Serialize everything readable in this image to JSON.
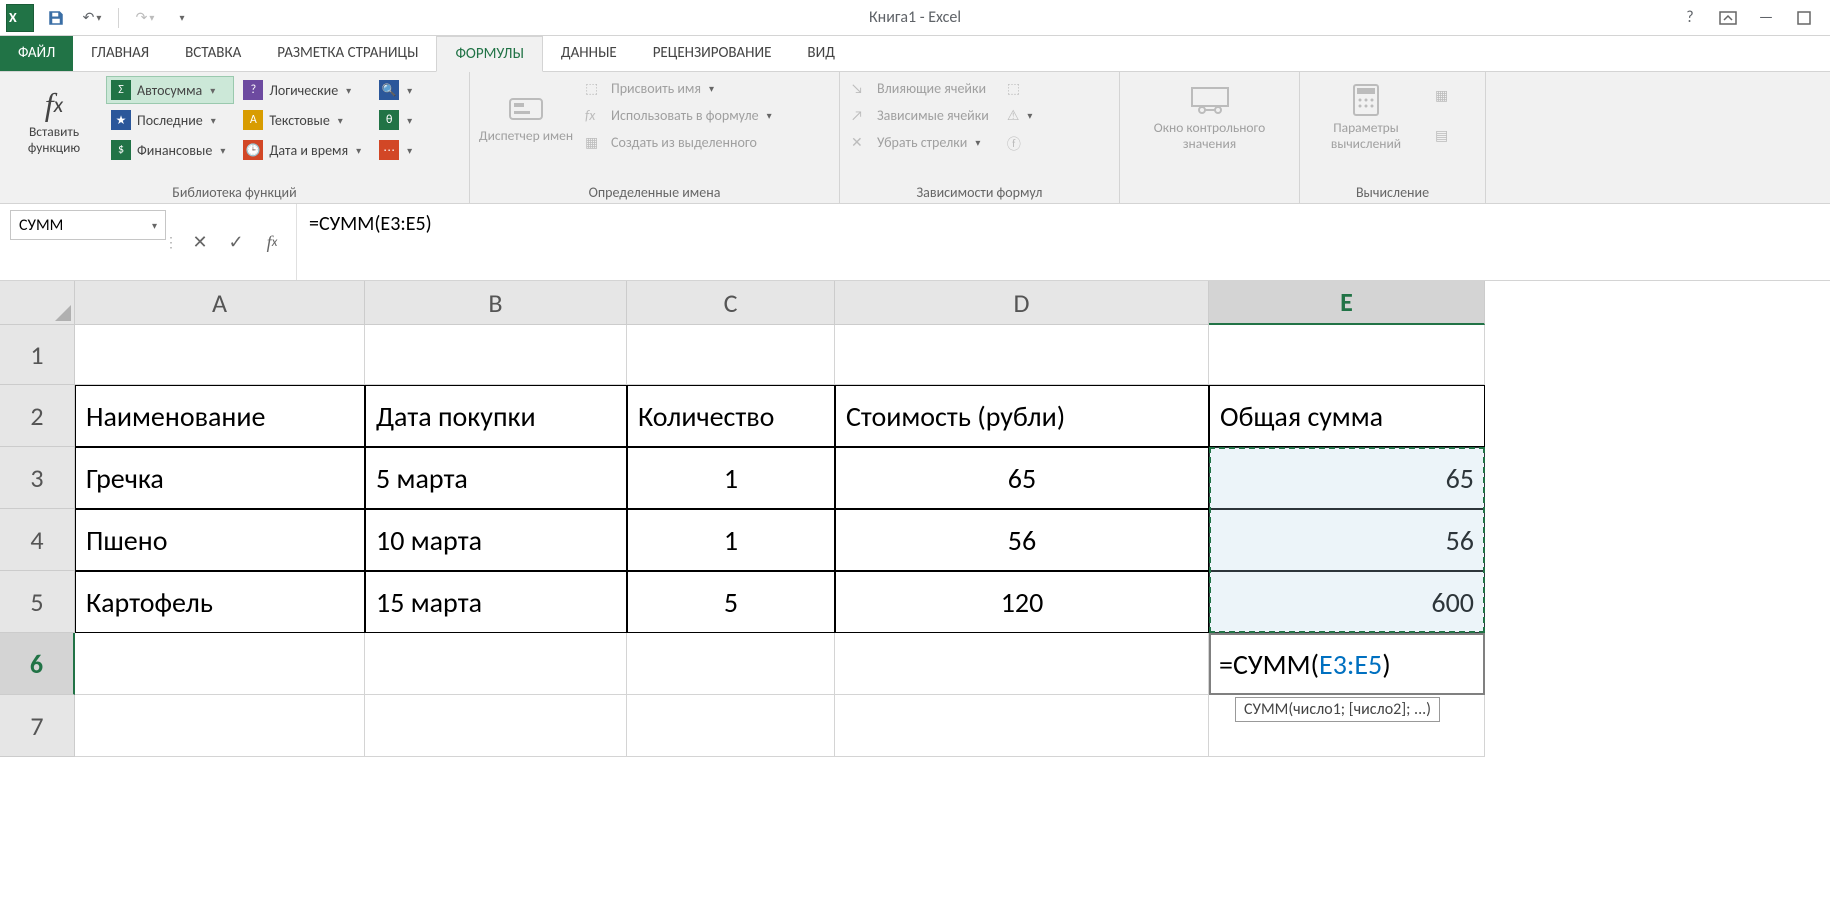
{
  "title": "Книга1 - Excel",
  "qat": {
    "undo_tip": "Отменить",
    "redo_tip": "Повторить",
    "save_tip": "Сохранить"
  },
  "tabs": {
    "file": "ФАЙЛ",
    "items": [
      "ГЛАВНАЯ",
      "ВСТАВКА",
      "РАЗМЕТКА СТРАНИЦЫ",
      "ФОРМУЛЫ",
      "ДАННЫЕ",
      "РЕЦЕНЗИРОВАНИЕ",
      "ВИД"
    ],
    "active_index": 3
  },
  "ribbon": {
    "insert_fn": {
      "label": "Вставить функцию"
    },
    "lib": {
      "autosum": "Автосумма",
      "recent": "Последние",
      "financial": "Финансовые",
      "logical": "Логические",
      "text": "Текстовые",
      "datetime": "Дата и время",
      "group_label": "Библиотека функций"
    },
    "names": {
      "manager": "Диспетчер имен",
      "define": "Присвоить имя",
      "usein": "Использовать в формуле",
      "create": "Создать из выделенного",
      "group_label": "Определенные имена"
    },
    "audit": {
      "precedents": "Влияющие ячейки",
      "dependents": "Зависимые ячейки",
      "remove": "Убрать стрелки",
      "group_label": "Зависимости формул"
    },
    "watch": {
      "label": "Окно контрольного значения"
    },
    "calc": {
      "options": "Параметры вычислений",
      "group_label": "Вычисление"
    }
  },
  "namebox": {
    "value": "СУММ"
  },
  "formula_bar": {
    "value": "=СУММ(E3:E5)"
  },
  "columns": [
    "A",
    "B",
    "C",
    "D",
    "E"
  ],
  "rows": [
    "1",
    "2",
    "3",
    "4",
    "5",
    "6",
    "7"
  ],
  "sheet": {
    "headers": [
      "Наименование",
      "Дата покупки",
      "Количество",
      "Стоимость (рубли)",
      "Общая сумма"
    ],
    "data": [
      {
        "name": "Гречка",
        "date": "5 марта",
        "qty": "1",
        "cost": "65",
        "total": "65"
      },
      {
        "name": "Пшено",
        "date": "10 марта",
        "qty": "1",
        "cost": "56",
        "total": "56"
      },
      {
        "name": "Картофель",
        "date": "15 марта",
        "qty": "5",
        "cost": "120",
        "total": "600"
      }
    ],
    "edit_cell": {
      "prefix": "=СУММ(",
      "range": "E3:E5",
      "suffix": ")"
    },
    "tooltip": "СУММ(число1; [число2]; ...)"
  }
}
